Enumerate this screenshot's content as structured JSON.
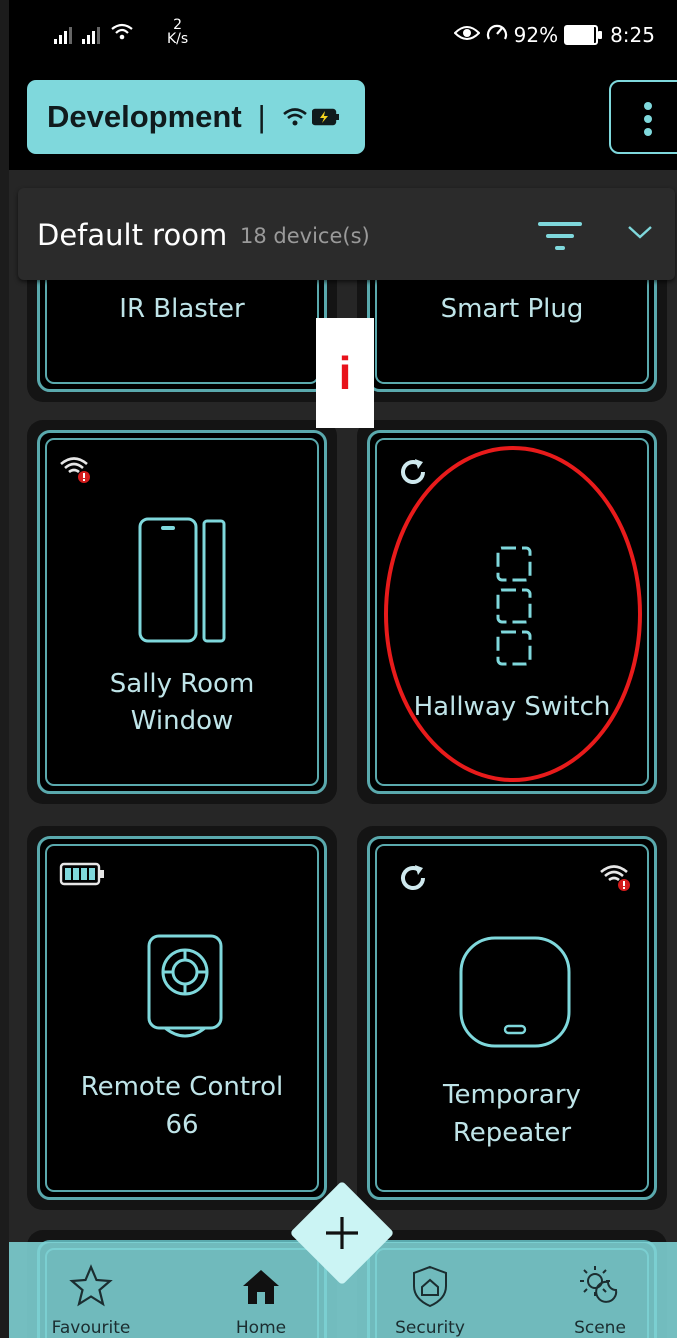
{
  "status_bar": {
    "net_speed_value": "2",
    "net_speed_unit": "K/s",
    "battery": "92%",
    "time": "8:25"
  },
  "header": {
    "environment": "Development",
    "separator": "|"
  },
  "room": {
    "name": "Default room",
    "device_count": "18 device(s)"
  },
  "devices": [
    {
      "label": "IR Blaster"
    },
    {
      "label": "Smart Plug"
    },
    {
      "label_line1": "Sally Room",
      "label_line2": "Window"
    },
    {
      "label": "Hallway Switch"
    },
    {
      "label_line1": "Remote Control",
      "label_line2": "66"
    },
    {
      "label_line1": "Temporary",
      "label_line2": "Repeater"
    }
  ],
  "info_marker": "i",
  "bottom_nav": [
    {
      "label": "Favourite",
      "icon": "star-icon"
    },
    {
      "label": "Home",
      "icon": "home-icon"
    },
    {
      "label": "Security",
      "icon": "shield-home-icon"
    },
    {
      "label": "Scene",
      "icon": "sun-moon-icon"
    }
  ],
  "fab": {
    "icon": "plus-icon"
  },
  "colors": {
    "accent": "#7fd8dc",
    "tile_border": "#5aa9ad",
    "highlight": "#e81b1b",
    "nav_bg": "#7fd4d6"
  }
}
